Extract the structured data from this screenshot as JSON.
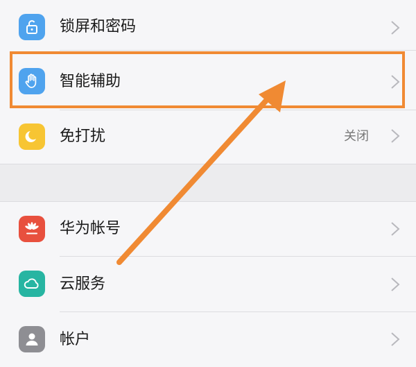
{
  "settings": {
    "items": [
      {
        "label": "锁屏和密码",
        "icon": "lock-icon",
        "color": "#4fa3ee"
      },
      {
        "label": "智能辅助",
        "icon": "hand-icon",
        "color": "#4fa3ee"
      },
      {
        "label": "免打扰",
        "icon": "moon-icon",
        "color": "#f7c533",
        "value": "关闭"
      },
      {
        "label": "华为帐号",
        "icon": "huawei-logo-icon",
        "color": "#e8503e"
      },
      {
        "label": "云服务",
        "icon": "cloud-icon",
        "color": "#27b5a2"
      },
      {
        "label": "帐户",
        "icon": "person-icon",
        "color": "#8e8e93"
      }
    ]
  },
  "annotation": {
    "highlight_color": "#f08a33",
    "arrow_color": "#f08a33"
  }
}
